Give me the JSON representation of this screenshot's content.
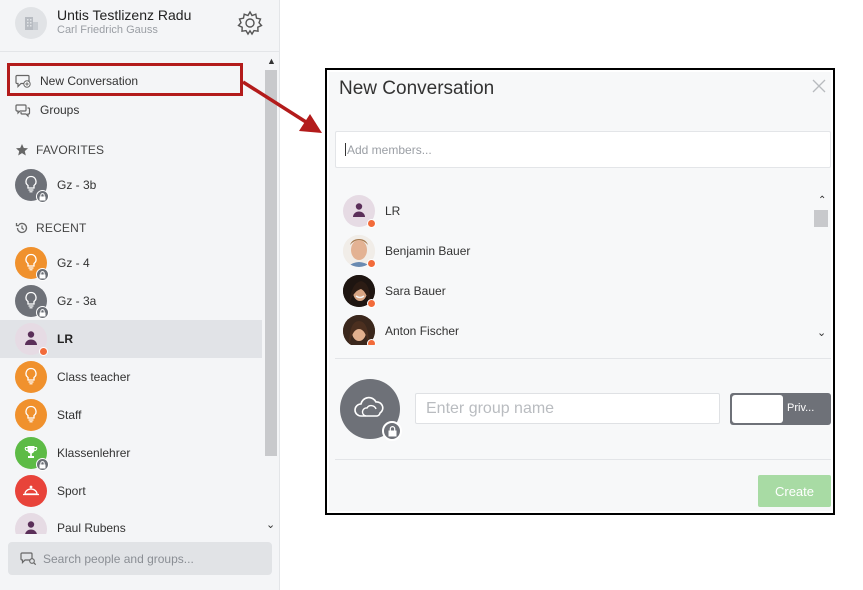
{
  "profile": {
    "name": "Untis Testlizenz Radu",
    "subtitle": "Carl Friedrich Gauss",
    "icons": {
      "school": "school-building-icon",
      "settings": "gear-icon"
    }
  },
  "nav": {
    "new_conversation": "New Conversation",
    "groups": "Groups"
  },
  "sections": {
    "favorites": "FAVORITES",
    "recent": "RECENT"
  },
  "favorites": [
    {
      "label": "Gz - 3b",
      "avatar_color": "#6e7178",
      "icon": "lightbulb-icon",
      "locked": true
    }
  ],
  "recent": [
    {
      "label": "Gz - 4",
      "avatar_color": "#f0912d",
      "icon": "lightbulb-icon",
      "locked": true,
      "active": false
    },
    {
      "label": "Gz - 3a",
      "avatar_color": "#6e7178",
      "icon": "lightbulb-icon",
      "locked": true,
      "active": false
    },
    {
      "label": "LR",
      "avatar_color": "#e6dbe4",
      "icon": "person-icon",
      "online_dot": true,
      "active": true
    },
    {
      "label": "Class teacher",
      "avatar_color": "#f0912d",
      "icon": "lightbulb-icon",
      "active": false
    },
    {
      "label": "Staff",
      "avatar_color": "#f0912d",
      "icon": "lightbulb-icon",
      "active": false
    },
    {
      "label": "Klassenlehrer",
      "avatar_color": "#5dbb46",
      "icon": "trophy-icon",
      "locked": true,
      "active": false
    },
    {
      "label": "Sport",
      "avatar_color": "#e8433a",
      "icon": "whistle-icon",
      "active": false
    },
    {
      "label": "Paul Rubens",
      "avatar_color": "#e6dbe4",
      "icon": "person-icon",
      "active": false
    }
  ],
  "search": {
    "placeholder": "Search people and groups..."
  },
  "dialog": {
    "title": "New Conversation",
    "members_placeholder": "Add members...",
    "members": [
      {
        "name": "LR",
        "avatar": "person-icon",
        "avatar_color": "#e6dbe4"
      },
      {
        "name": "Benjamin Bauer",
        "avatar": "photo-avatar-icon",
        "avatar_color": "#d9a07d"
      },
      {
        "name": "Sara Bauer",
        "avatar": "photo-avatar-icon",
        "avatar_color": "#3a2a22"
      },
      {
        "name": "Anton Fischer",
        "avatar": "photo-avatar-icon",
        "avatar_color": "#5a3b2a"
      }
    ],
    "group_name_placeholder": "Enter group name",
    "privacy_label": "Priv...",
    "create_label": "Create"
  },
  "colors": {
    "accent_red": "#b31b1b",
    "online_dot": "#f26b3a",
    "create_disabled": "#a8dba4"
  }
}
